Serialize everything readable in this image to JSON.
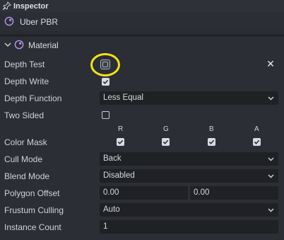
{
  "panel": {
    "title": "Inspector"
  },
  "asset": {
    "name": "Uber PBR",
    "icon": "material-sphere-icon"
  },
  "section": {
    "label": "Material",
    "icon": "material-sphere-icon",
    "expanded": true
  },
  "properties": {
    "depth_test": {
      "label": "Depth Test",
      "checked": false
    },
    "depth_write": {
      "label": "Depth Write",
      "checked": true
    },
    "depth_function": {
      "label": "Depth Function",
      "value": "Less Equal"
    },
    "two_sided": {
      "label": "Two Sided",
      "checked": false
    },
    "color_mask": {
      "label": "Color Mask",
      "channels": [
        "R",
        "G",
        "B",
        "A"
      ],
      "checked": [
        true,
        true,
        true,
        true
      ]
    },
    "cull_mode": {
      "label": "Cull Mode",
      "value": "Back"
    },
    "blend_mode": {
      "label": "Blend Mode",
      "value": "Disabled"
    },
    "polygon_offset": {
      "label": "Polygon Offset",
      "value1": "0.00",
      "value2": "0.00"
    },
    "frustum_culling": {
      "label": "Frustum Culling",
      "value": "Auto"
    },
    "instance_count": {
      "label": "Instance Count",
      "value": "1"
    }
  },
  "colors": {
    "background": "#2b2e34",
    "field": "#1f2125",
    "highlight": "#f3e21a",
    "accent": "#b995f0"
  }
}
